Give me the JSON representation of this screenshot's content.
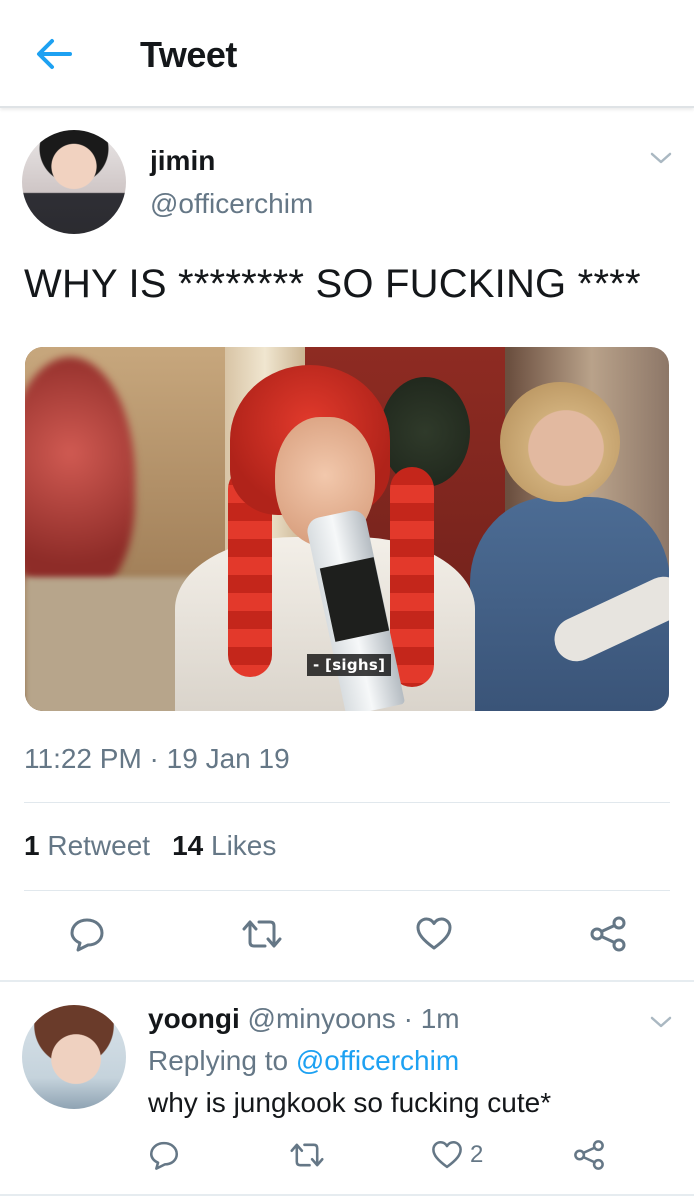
{
  "header": {
    "title": "Tweet",
    "back_icon": "back-arrow-icon",
    "accent_color": "#1da1f2"
  },
  "tweet": {
    "author_name": "jimin",
    "author_handle": "@officerchim",
    "text": "WHY IS ******** SO FUCKING ****",
    "media_caption": "- [sighs]",
    "time": "11:22 PM",
    "separator": " · ",
    "date": "19 Jan 19",
    "retweet_count": "1",
    "retweet_label": "Retweet",
    "like_count": "14",
    "like_label": "Likes",
    "actions": [
      "reply-icon",
      "retweet-icon",
      "like-icon",
      "share-icon"
    ]
  },
  "reply": {
    "author_name": "yoongi",
    "author_handle": "@minyoons",
    "separator": " · ",
    "age": "1m",
    "replying_prefix": "Replying to ",
    "replying_to": "@officerchim",
    "text": "why is jungkook so fucking cute*",
    "like_count": "2",
    "actions": [
      "reply-icon",
      "retweet-icon",
      "like-icon",
      "share-icon"
    ]
  },
  "colors": {
    "text": "#14171a",
    "secondary": "#657786",
    "link": "#1da1f2",
    "divider": "#e1e8ed"
  }
}
